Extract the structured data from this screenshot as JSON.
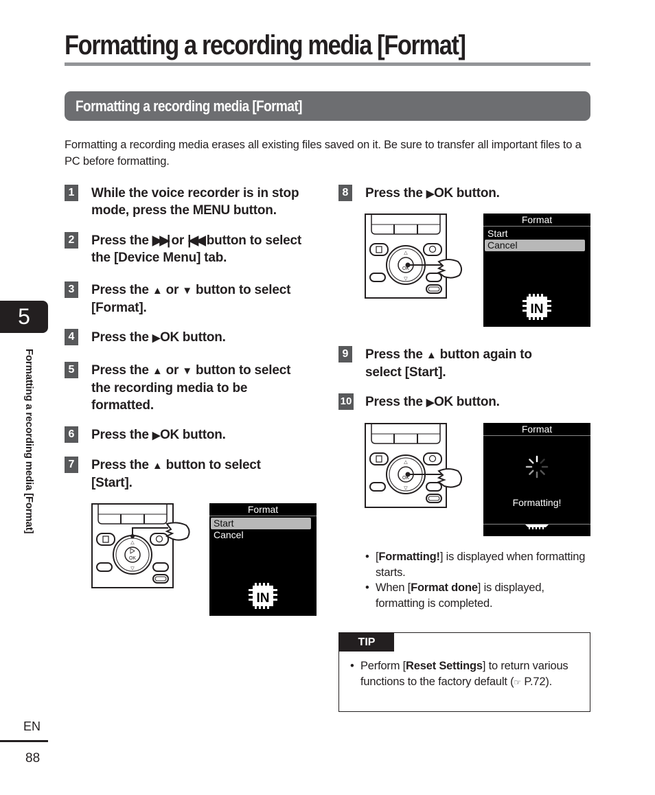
{
  "page": {
    "title": "Formatting a recording media [Format]",
    "section_title": "Formatting a recording media [Format]",
    "intro": "Formatting a recording media erases all existing files saved on it. Be sure to transfer all important files to a PC before formatting.",
    "chapter_number": "5",
    "side_label": "Formatting a recording media [Format]",
    "language": "EN",
    "page_number": "88"
  },
  "symbols": {
    "up": "▲",
    "down": "▼",
    "right": "▶",
    "ff": "▶▶|",
    "rew": "|◀◀",
    "ok": "OK",
    "ref": "☞"
  },
  "steps": [
    {
      "num": "1",
      "parts": [
        "While the voice recorder is in stop mode, press the ",
        "MENU",
        " button."
      ]
    },
    {
      "num": "2",
      "parts": [
        "Press the ",
        "▶▶|",
        " or ",
        "|◀◀",
        " button to select the [",
        "Device Menu",
        "] tab."
      ]
    },
    {
      "num": "3",
      "parts": [
        "Press the ",
        "▲",
        " or ",
        "▼",
        " button to select [",
        "Format",
        "]."
      ]
    },
    {
      "num": "4",
      "parts": [
        "Press the ",
        "▶",
        "OK",
        " button."
      ]
    },
    {
      "num": "5",
      "parts": [
        "Press the ",
        "▲",
        " or ",
        "▼",
        " button to select the recording media to be formatted."
      ]
    },
    {
      "num": "6",
      "parts": [
        "Press the ",
        "▶",
        "OK",
        " button."
      ]
    },
    {
      "num": "7",
      "parts": [
        "Press the ",
        "▲",
        " button to select [",
        "Start",
        "]."
      ]
    },
    {
      "num": "8",
      "parts": [
        "Press the ",
        "▶",
        "OK",
        " button."
      ]
    },
    {
      "num": "9",
      "parts": [
        "Press the ",
        "▲",
        " button again to select [",
        "Start",
        "]."
      ]
    },
    {
      "num": "10",
      "parts": [
        "Press the ",
        "▶",
        "OK",
        " button."
      ]
    }
  ],
  "screens": {
    "step7": {
      "title": "Format",
      "items": [
        "Start",
        "Cancel"
      ],
      "selected": "Start",
      "media_icon": "IN"
    },
    "step8": {
      "title": "Format",
      "items": [
        "Start",
        "Cancel"
      ],
      "selected": "Cancel",
      "media_icon": "IN"
    },
    "step10": {
      "title": "Format",
      "status": "Formatting!"
    }
  },
  "device": {
    "ok_label": "OK"
  },
  "notes": [
    {
      "pre": "[",
      "bold": "Formatting!",
      "post": "] is displayed when formatting starts."
    },
    {
      "pre": "When [",
      "bold": "Format done",
      "post": "] is displayed, formatting is completed."
    }
  ],
  "tip": {
    "label": "TIP",
    "items": [
      {
        "pre": "Perform [",
        "bold": "Reset Settings",
        "post": "] to return various functions to the factory default (",
        "ref_icon": "☞",
        "ref": " P.72)."
      }
    ]
  }
}
